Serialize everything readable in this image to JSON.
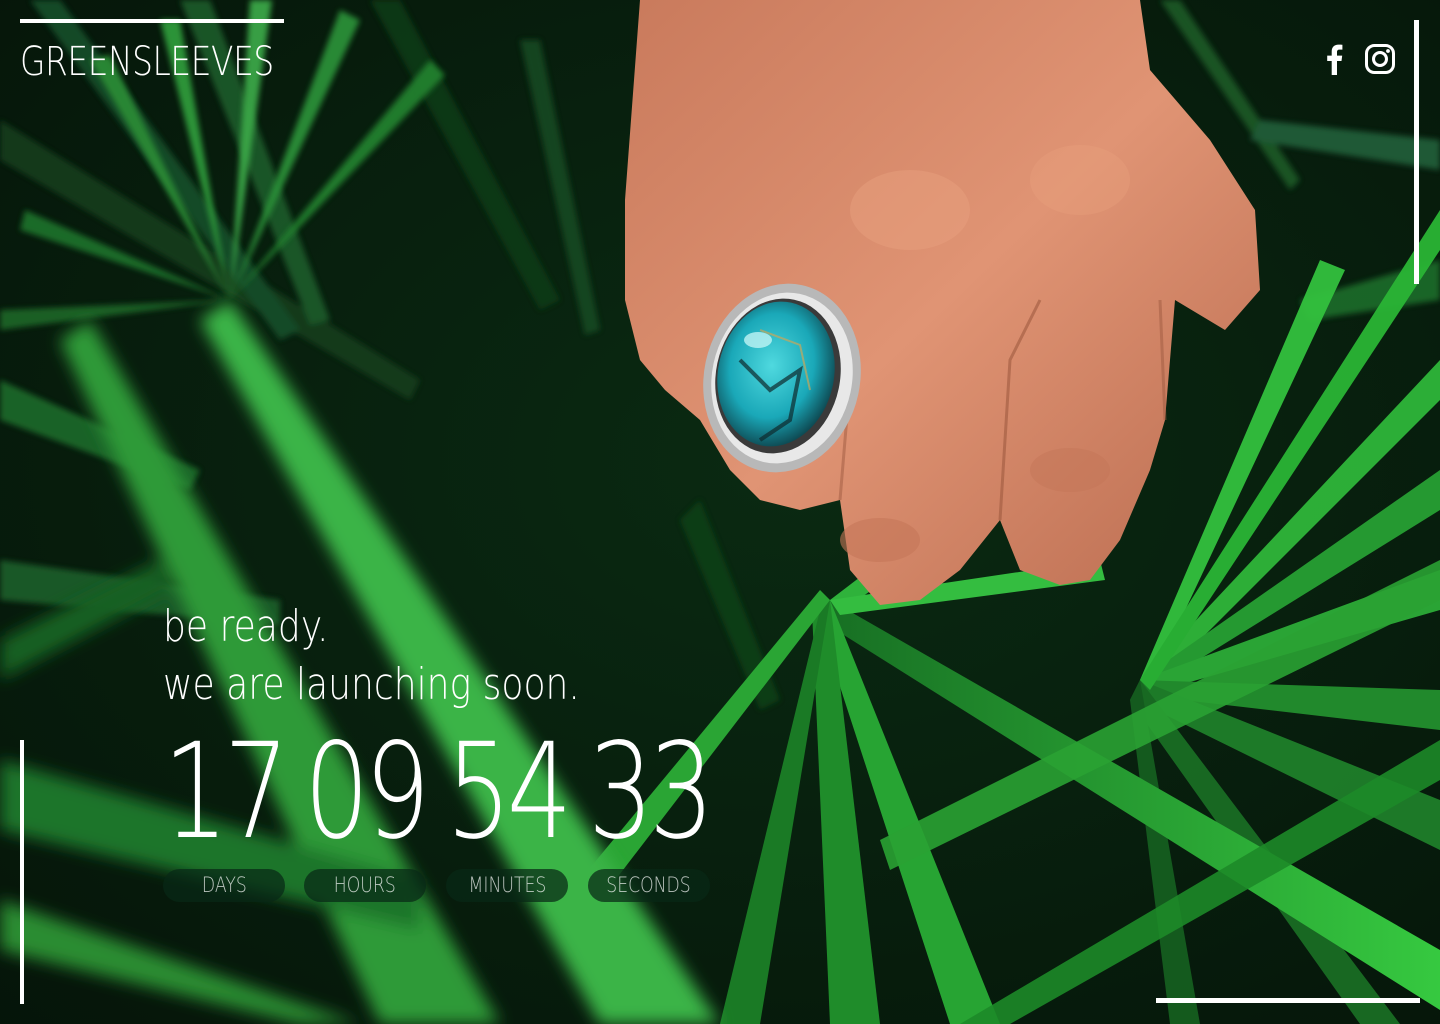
{
  "brand": {
    "name": "GREENSLEEVES"
  },
  "social": {
    "facebook_icon": "facebook-icon",
    "instagram_icon": "instagram-icon"
  },
  "headline": {
    "line1": "be ready.",
    "line2": "we are launching soon."
  },
  "countdown": {
    "units": [
      {
        "value": "17",
        "label": "DAYS"
      },
      {
        "value": "09",
        "label": "HOURS"
      },
      {
        "value": "54",
        "label": "MINUTES"
      },
      {
        "value": "33",
        "label": "SECONDS"
      }
    ]
  },
  "colors": {
    "text": "#ffffff",
    "label_pill": "#082816",
    "foliage_dark": "#0b2410",
    "foliage_bright": "#1f9a2c",
    "skin": "#d98a68",
    "turquoise": "#1fb6c4"
  }
}
